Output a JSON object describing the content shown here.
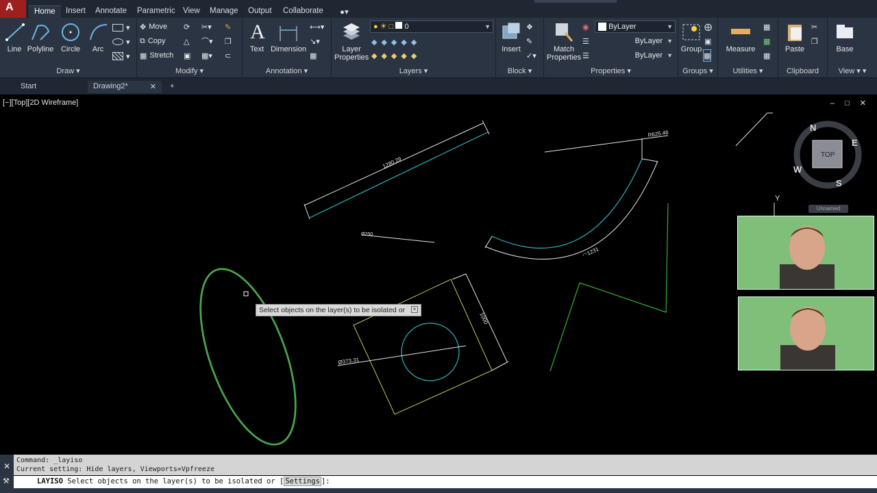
{
  "ribbon_tabs": [
    "Home",
    "Insert",
    "Annotate",
    "Parametric",
    "View",
    "Manage",
    "Output",
    "Collaborate"
  ],
  "active_tab": "Home",
  "panels": {
    "draw": {
      "title": "Draw",
      "line": "Line",
      "polyline": "Polyline",
      "circle": "Circle",
      "arc": "Arc"
    },
    "modify": {
      "title": "Modify",
      "move": "Move",
      "copy": "Copy",
      "stretch": "Stretch"
    },
    "annotation": {
      "title": "Annotation",
      "text": "Text",
      "dimension": "Dimension"
    },
    "layers": {
      "title": "Layers",
      "layer_properties_1": "Layer",
      "layer_properties_2": "Properties",
      "current_layer": "0"
    },
    "block": {
      "title": "Block",
      "insert": "Insert"
    },
    "properties": {
      "title": "Properties",
      "match_1": "Match",
      "match_2": "Properties",
      "color": "ByLayer",
      "linetype": "ByLayer",
      "lineweight": "ByLayer"
    },
    "groups": {
      "title": "Groups",
      "group": "Group"
    },
    "utilities": {
      "title": "Utilities",
      "measure": "Measure"
    },
    "clipboard": {
      "title": "Clipboard",
      "paste": "Paste"
    },
    "view": {
      "title": "View",
      "base": "Base"
    }
  },
  "file_tabs": {
    "start": "Start",
    "drawing": "Drawing2*"
  },
  "viewport": {
    "label": "[−][Top][2D Wireframe]",
    "controls": "– □ ✕",
    "viewcube": {
      "top": "TOP",
      "n": "N",
      "e": "E",
      "s": "S",
      "w": "W"
    },
    "ucs_y": "Y",
    "wcs_menu": "Unnamed",
    "dims": {
      "aligned": "1280.29",
      "radius": "R625.46",
      "arc_len": "◠1231",
      "diam_small": "Ø250",
      "diam_circle": "Ø373.31",
      "square": "1000"
    }
  },
  "tooltip": "Select objects on the layer(s) to be isolated or",
  "command_history": [
    "Command: _layiso",
    "Current setting: Hide layers, Viewports=Vpfreeze"
  ],
  "command_line": {
    "cmd": "LAYISO",
    "prompt": "Select objects on the layer(s) to be isolated or [",
    "keyword": "Settings",
    "end": "]:"
  },
  "colors": {
    "ribbon_bg": "#2b3442",
    "tab_bg": "#1f2733",
    "cyan": "#2fb5c4",
    "yellow": "#c9c950",
    "green": "#33b233",
    "ellipse_green": "#6bd96b"
  }
}
